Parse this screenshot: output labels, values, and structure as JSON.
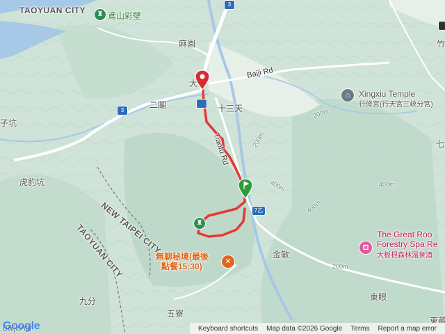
{
  "labels": {
    "taoyuan_city_top": "TAOYUAN CITY",
    "yingshan_mural": "鳶山彩壁",
    "maxiang": "麻園",
    "da": "大",
    "baiji_rd": "Baiji Rd",
    "xingxiu_temple": "Xingxiu Temple",
    "xingxiu_temple_zh": "行修宮(行天宮三峽分宮)",
    "erlan": "二鬮",
    "shisantian": "十三天",
    "zikeng": "子坑",
    "tiaofu_rd": "Tiaofu Rd",
    "hubaokeng": "虎豹坑",
    "new_taipei_city": "NEW TAIPEI CITY",
    "taoyuan_city_mid": "TAOYUAN CITY",
    "great_roots_1": "The Great Roo",
    "great_roots_2": "Forestry Spa Re",
    "great_roots_zh": "大板根森林溫泉酒",
    "jinmin": "金敏",
    "restaurant_1": "無聊秘境(最後",
    "restaurant_2": "點餐15:30)",
    "jiufen": "九分",
    "wuliao": "五寮",
    "dongyan": "東眼",
    "dongxie": "東藏",
    "baijishan": "Baijishan",
    "qi": "七",
    "zhu": "竹"
  },
  "shields": {
    "route3_top": "3",
    "route3_left": "3",
    "route7_right": "7乙"
  },
  "contour_labels": [
    "200m",
    "400m",
    "400m",
    "400m",
    "200m",
    "200m"
  ],
  "route_markers": {
    "start_color": "#2e9b3a",
    "end_color": "#d32f2f",
    "track_color": "#e53935"
  },
  "colors": {
    "water": "#a8c8e8",
    "terrain": "#cfe3d8",
    "road": "#ffffff"
  },
  "footer": {
    "logo": "Google",
    "keyboard_shortcuts": "Keyboard shortcuts",
    "map_data": "Map data ©2026 Google",
    "terms": "Terms",
    "report": "Report a map error"
  }
}
